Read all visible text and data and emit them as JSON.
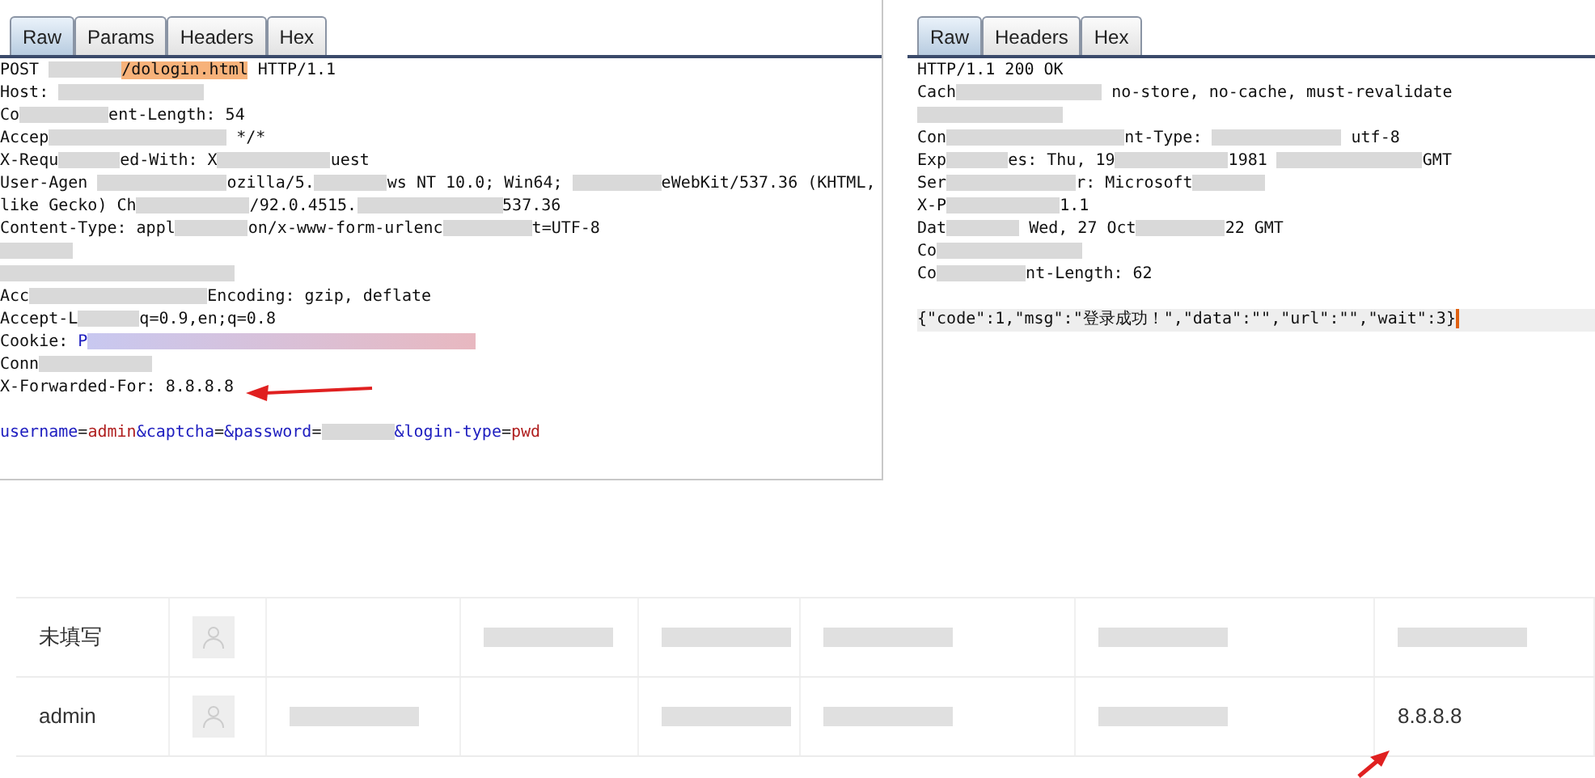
{
  "request": {
    "tabs": [
      {
        "label": "Raw",
        "selected": true
      },
      {
        "label": "Params",
        "selected": false
      },
      {
        "label": "Headers",
        "selected": false
      },
      {
        "label": "Hex",
        "selected": false
      }
    ],
    "lines": [
      [
        {
          "kind": "plain",
          "text": "POST "
        },
        {
          "kind": "redacted"
        },
        {
          "kind": "highlight",
          "text": "/dologin.html"
        },
        {
          "kind": "plain",
          "text": " HTTP/1.1"
        }
      ],
      [
        {
          "kind": "plain",
          "text": "Host: "
        },
        {
          "kind": "redacted"
        }
      ],
      [
        {
          "kind": "plain",
          "text": "Co"
        },
        {
          "kind": "redacted"
        },
        {
          "kind": "plain",
          "text": "ent-Length: 54"
        }
      ],
      [
        {
          "kind": "plain",
          "text": "Accep"
        },
        {
          "kind": "redacted"
        },
        {
          "kind": "plain",
          "text": " */*"
        }
      ],
      [
        {
          "kind": "plain",
          "text": "X-Requ"
        },
        {
          "kind": "redacted"
        },
        {
          "kind": "plain",
          "text": "ed-With: X"
        },
        {
          "kind": "redacted"
        },
        {
          "kind": "plain",
          "text": "uest"
        }
      ],
      [
        {
          "kind": "plain",
          "text": "User-Agen "
        },
        {
          "kind": "redacted"
        },
        {
          "kind": "plain",
          "text": "ozilla/5."
        },
        {
          "kind": "redacted"
        },
        {
          "kind": "plain",
          "text": "ws NT 10.0; Win64; "
        },
        {
          "kind": "redacted"
        },
        {
          "kind": "plain",
          "text": "eWebKit/537.36 (KHTML,"
        }
      ],
      [
        {
          "kind": "plain",
          "text": "like Gecko) Ch"
        },
        {
          "kind": "redacted"
        },
        {
          "kind": "plain",
          "text": "/92.0.4515."
        },
        {
          "kind": "redacted"
        },
        {
          "kind": "plain",
          "text": "537.36"
        }
      ],
      [
        {
          "kind": "plain",
          "text": "Content-Type: appl"
        },
        {
          "kind": "redacted"
        },
        {
          "kind": "plain",
          "text": "on/x-www-form-urlenc"
        },
        {
          "kind": "redacted"
        },
        {
          "kind": "plain",
          "text": "t=UTF-8"
        }
      ],
      [
        {
          "kind": "redacted"
        }
      ],
      [
        {
          "kind": "redacted"
        },
        {
          "kind": "redacted"
        }
      ],
      [
        {
          "kind": "plain",
          "text": "Acc"
        },
        {
          "kind": "redacted"
        },
        {
          "kind": "plain",
          "text": "Encoding: gzip, deflate"
        }
      ],
      [
        {
          "kind": "plain",
          "text": "Accept-L"
        },
        {
          "kind": "redacted"
        },
        {
          "kind": "plain",
          "text": "q=0.9,en;q=0.8"
        }
      ],
      [
        {
          "kind": "plain",
          "text": "Cookie: "
        },
        {
          "kind": "param_name",
          "text": "P"
        },
        {
          "kind": "redacted_cookie"
        }
      ],
      [
        {
          "kind": "plain",
          "text": "Conn"
        },
        {
          "kind": "redacted"
        }
      ],
      [
        {
          "kind": "plain",
          "text": "X-Forwarded-For: 8.8.8.8"
        }
      ]
    ],
    "body": [
      [
        {
          "kind": "param_name",
          "text": "username"
        },
        {
          "kind": "plain",
          "text": "="
        },
        {
          "kind": "param_value",
          "text": "admin"
        },
        {
          "kind": "param_name",
          "text": "&captcha"
        },
        {
          "kind": "plain",
          "text": "="
        },
        {
          "kind": "param_name",
          "text": "&password"
        },
        {
          "kind": "plain",
          "text": "="
        },
        {
          "kind": "redacted"
        },
        {
          "kind": "param_name",
          "text": "&login-type"
        },
        {
          "kind": "plain",
          "text": "="
        },
        {
          "kind": "param_value",
          "text": "pwd"
        }
      ]
    ]
  },
  "response": {
    "tabs": [
      {
        "label": "Raw",
        "selected": true
      },
      {
        "label": "Headers",
        "selected": false
      },
      {
        "label": "Hex",
        "selected": false
      }
    ],
    "lines": [
      [
        {
          "kind": "plain",
          "text": "HTTP/1.1 200 OK"
        }
      ],
      [
        {
          "kind": "plain",
          "text": "Cach"
        },
        {
          "kind": "redacted"
        },
        {
          "kind": "plain",
          "text": " no-store, no-cache, must-revalidate"
        }
      ],
      [
        {
          "kind": "redacted"
        }
      ],
      [
        {
          "kind": "plain",
          "text": "Con"
        },
        {
          "kind": "redacted"
        },
        {
          "kind": "plain",
          "text": "nt-Type: "
        },
        {
          "kind": "redacted"
        },
        {
          "kind": "plain",
          "text": " utf-8"
        }
      ],
      [
        {
          "kind": "plain",
          "text": "Exp"
        },
        {
          "kind": "redacted"
        },
        {
          "kind": "plain",
          "text": "es: Thu, 19"
        },
        {
          "kind": "redacted"
        },
        {
          "kind": "plain",
          "text": "1981 "
        },
        {
          "kind": "redacted"
        },
        {
          "kind": "plain",
          "text": "GMT"
        }
      ],
      [
        {
          "kind": "plain",
          "text": "Ser"
        },
        {
          "kind": "redacted"
        },
        {
          "kind": "plain",
          "text": "r: Microsoft"
        },
        {
          "kind": "redacted"
        }
      ],
      [
        {
          "kind": "plain",
          "text": "X-P"
        },
        {
          "kind": "redacted"
        },
        {
          "kind": "plain",
          "text": "1.1"
        }
      ],
      [
        {
          "kind": "plain",
          "text": "Dat"
        },
        {
          "kind": "redacted"
        },
        {
          "kind": "plain",
          "text": " Wed, 27 Oct"
        },
        {
          "kind": "redacted"
        },
        {
          "kind": "plain",
          "text": "22 GMT"
        }
      ],
      [
        {
          "kind": "plain",
          "text": "Co"
        },
        {
          "kind": "redacted"
        }
      ],
      [
        {
          "kind": "plain",
          "text": "Co"
        },
        {
          "kind": "redacted"
        },
        {
          "kind": "plain",
          "text": "nt-Length: 62"
        }
      ]
    ],
    "body": [
      [
        {
          "kind": "plain",
          "text": "{\"code\":1,\"msg\":\"登录成功！\",\"data\":\"\",\"url\":\"\",\"wait\":3}"
        }
      ]
    ]
  },
  "table": {
    "rows": [
      {
        "cells": [
          {
            "kind": "text",
            "text": "未填写"
          },
          {
            "kind": "avatar"
          },
          {
            "kind": "empty"
          },
          {
            "kind": "redacted"
          },
          {
            "kind": "redacted"
          },
          {
            "kind": "redacted"
          },
          {
            "kind": "redacted"
          },
          {
            "kind": "redacted"
          }
        ]
      },
      {
        "cells": [
          {
            "kind": "text",
            "text": "admin"
          },
          {
            "kind": "avatar"
          },
          {
            "kind": "redacted"
          },
          {
            "kind": "empty"
          },
          {
            "kind": "redacted"
          },
          {
            "kind": "redacted"
          },
          {
            "kind": "redacted"
          },
          {
            "kind": "text",
            "text": "8.8.8.8"
          }
        ]
      }
    ]
  }
}
